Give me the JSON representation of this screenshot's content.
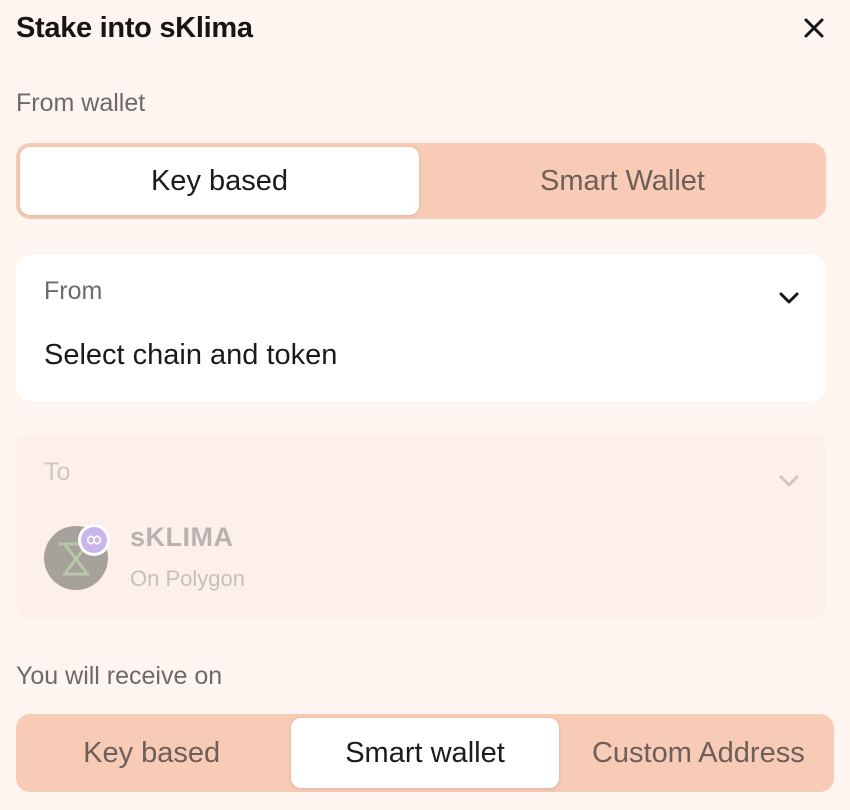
{
  "header": {
    "title": "Stake into sKlima",
    "close_icon": "close-icon"
  },
  "from_wallet": {
    "label": "From wallet",
    "options": [
      "Key based",
      "Smart Wallet"
    ],
    "selected": "Key based"
  },
  "from_card": {
    "label": "From",
    "value": "Select chain and token",
    "icon": "chevron-down-icon"
  },
  "to_card": {
    "label": "To",
    "token_name": "sKLIMA",
    "chain": "On Polygon",
    "icon": "chevron-down-icon"
  },
  "receive": {
    "label": "You will receive on",
    "options": [
      "Key based",
      "Smart wallet",
      "Custom Address"
    ],
    "selected": "Smart wallet"
  },
  "colors": {
    "background": "#fef4f0",
    "segment_bg": "#f8cbb6",
    "active_segment": "#ffffff",
    "chain_badge": "#c9b6ea"
  }
}
